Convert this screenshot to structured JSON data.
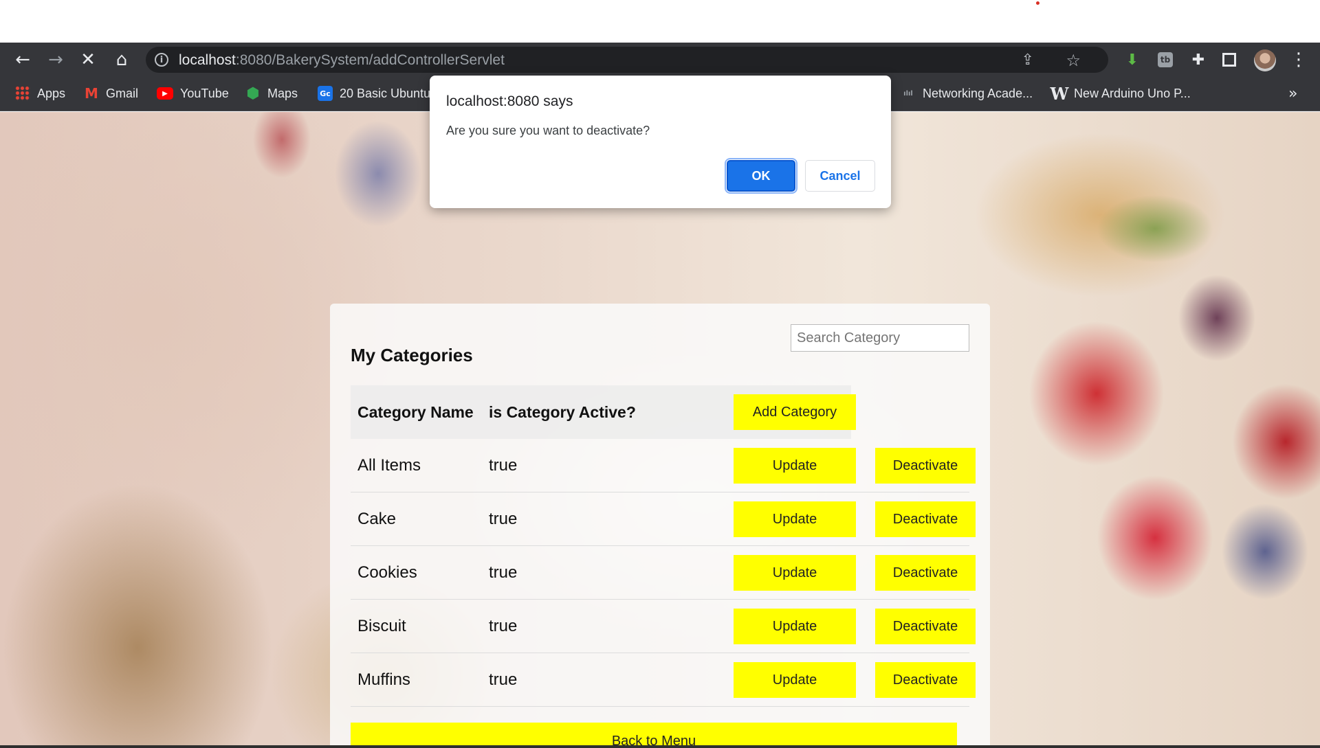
{
  "browser": {
    "url_host": "localhost",
    "url_rest": ":8080/BakerySystem/addControllerServlet",
    "bookmarks": [
      {
        "label": "Apps",
        "icon": "apps-grid-icon"
      },
      {
        "label": "Gmail",
        "icon": "gmail-icon"
      },
      {
        "label": "YouTube",
        "icon": "youtube-icon"
      },
      {
        "label": "Maps",
        "icon": "maps-icon"
      },
      {
        "label": "20 Basic Ubuntu",
        "icon": "ubuntu-bookmark-icon"
      },
      {
        "label": "Networking Acade...",
        "icon": "cisco-icon"
      },
      {
        "label": "New Arduino Uno P...",
        "icon": "arduino-w-icon"
      }
    ],
    "more_bookmarks": "»"
  },
  "page": {
    "title": "My Categories",
    "search_placeholder": "Search Category",
    "columns": [
      "Category Name",
      "is Category Active?"
    ],
    "add_label": "Add Category",
    "rows": [
      {
        "name": "All Items",
        "active": "true"
      },
      {
        "name": "Cake",
        "active": "true"
      },
      {
        "name": "Cookies",
        "active": "true"
      },
      {
        "name": "Biscuit",
        "active": "true"
      },
      {
        "name": "Muffins",
        "active": "true"
      }
    ],
    "update_label": "Update",
    "deactivate_label": "Deactivate",
    "back_label": "Back to Menu"
  },
  "dialog": {
    "title": "localhost:8080 says",
    "message": "Are you sure you want to deactivate?",
    "ok": "OK",
    "cancel": "Cancel"
  },
  "colors": {
    "button_yellow": "#ffff00",
    "dialog_ok_blue": "#1a73e8",
    "browser_chrome": "#35363a"
  }
}
